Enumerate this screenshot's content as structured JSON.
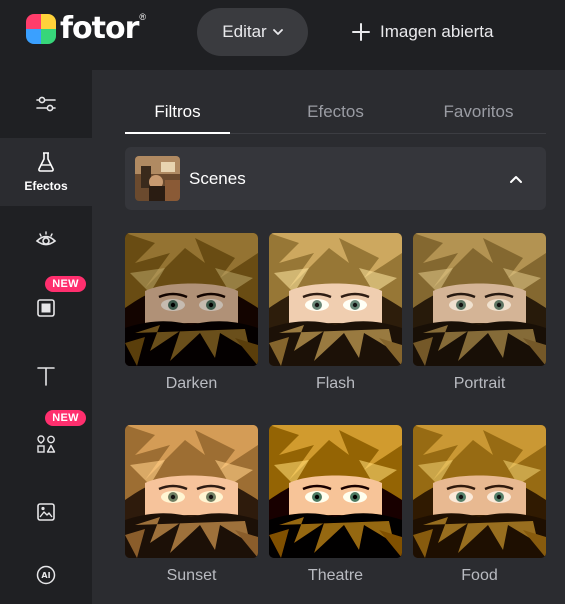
{
  "app": {
    "logo_text": "fotor",
    "logo_reg": "®"
  },
  "header": {
    "edit_label": "Editar",
    "open_label": "Imagen abierta"
  },
  "sidebar": {
    "items": [
      {
        "icon": "sliders-icon",
        "label": ""
      },
      {
        "icon": "flask-icon",
        "label": "Efectos",
        "active": true
      },
      {
        "icon": "eye-icon",
        "label": ""
      },
      {
        "icon": "frame-icon",
        "label": "",
        "badge": "NEW"
      },
      {
        "icon": "text-icon",
        "label": ""
      },
      {
        "icon": "elements-icon",
        "label": "",
        "badge": "NEW"
      },
      {
        "icon": "image-stack-icon",
        "label": ""
      },
      {
        "icon": "ai-icon",
        "label": ""
      }
    ],
    "badge_color": "#ff2f6e"
  },
  "tabs": [
    {
      "label": "Filtros",
      "active": true
    },
    {
      "label": "Efectos",
      "active": false
    },
    {
      "label": "Favoritos",
      "active": false
    }
  ],
  "section": {
    "title": "Scenes",
    "expanded": true
  },
  "filters": [
    {
      "label": "Darken",
      "tone": "darken"
    },
    {
      "label": "Flash",
      "tone": "flash"
    },
    {
      "label": "Portrait",
      "tone": "portrait"
    },
    {
      "label": "Sunset",
      "tone": "sunset"
    },
    {
      "label": "Theatre",
      "tone": "theatre"
    },
    {
      "label": "Food",
      "tone": "food"
    }
  ],
  "colors": {
    "background": "#1f2023",
    "panel": "#2b2c30",
    "accent": "#ffffff"
  }
}
